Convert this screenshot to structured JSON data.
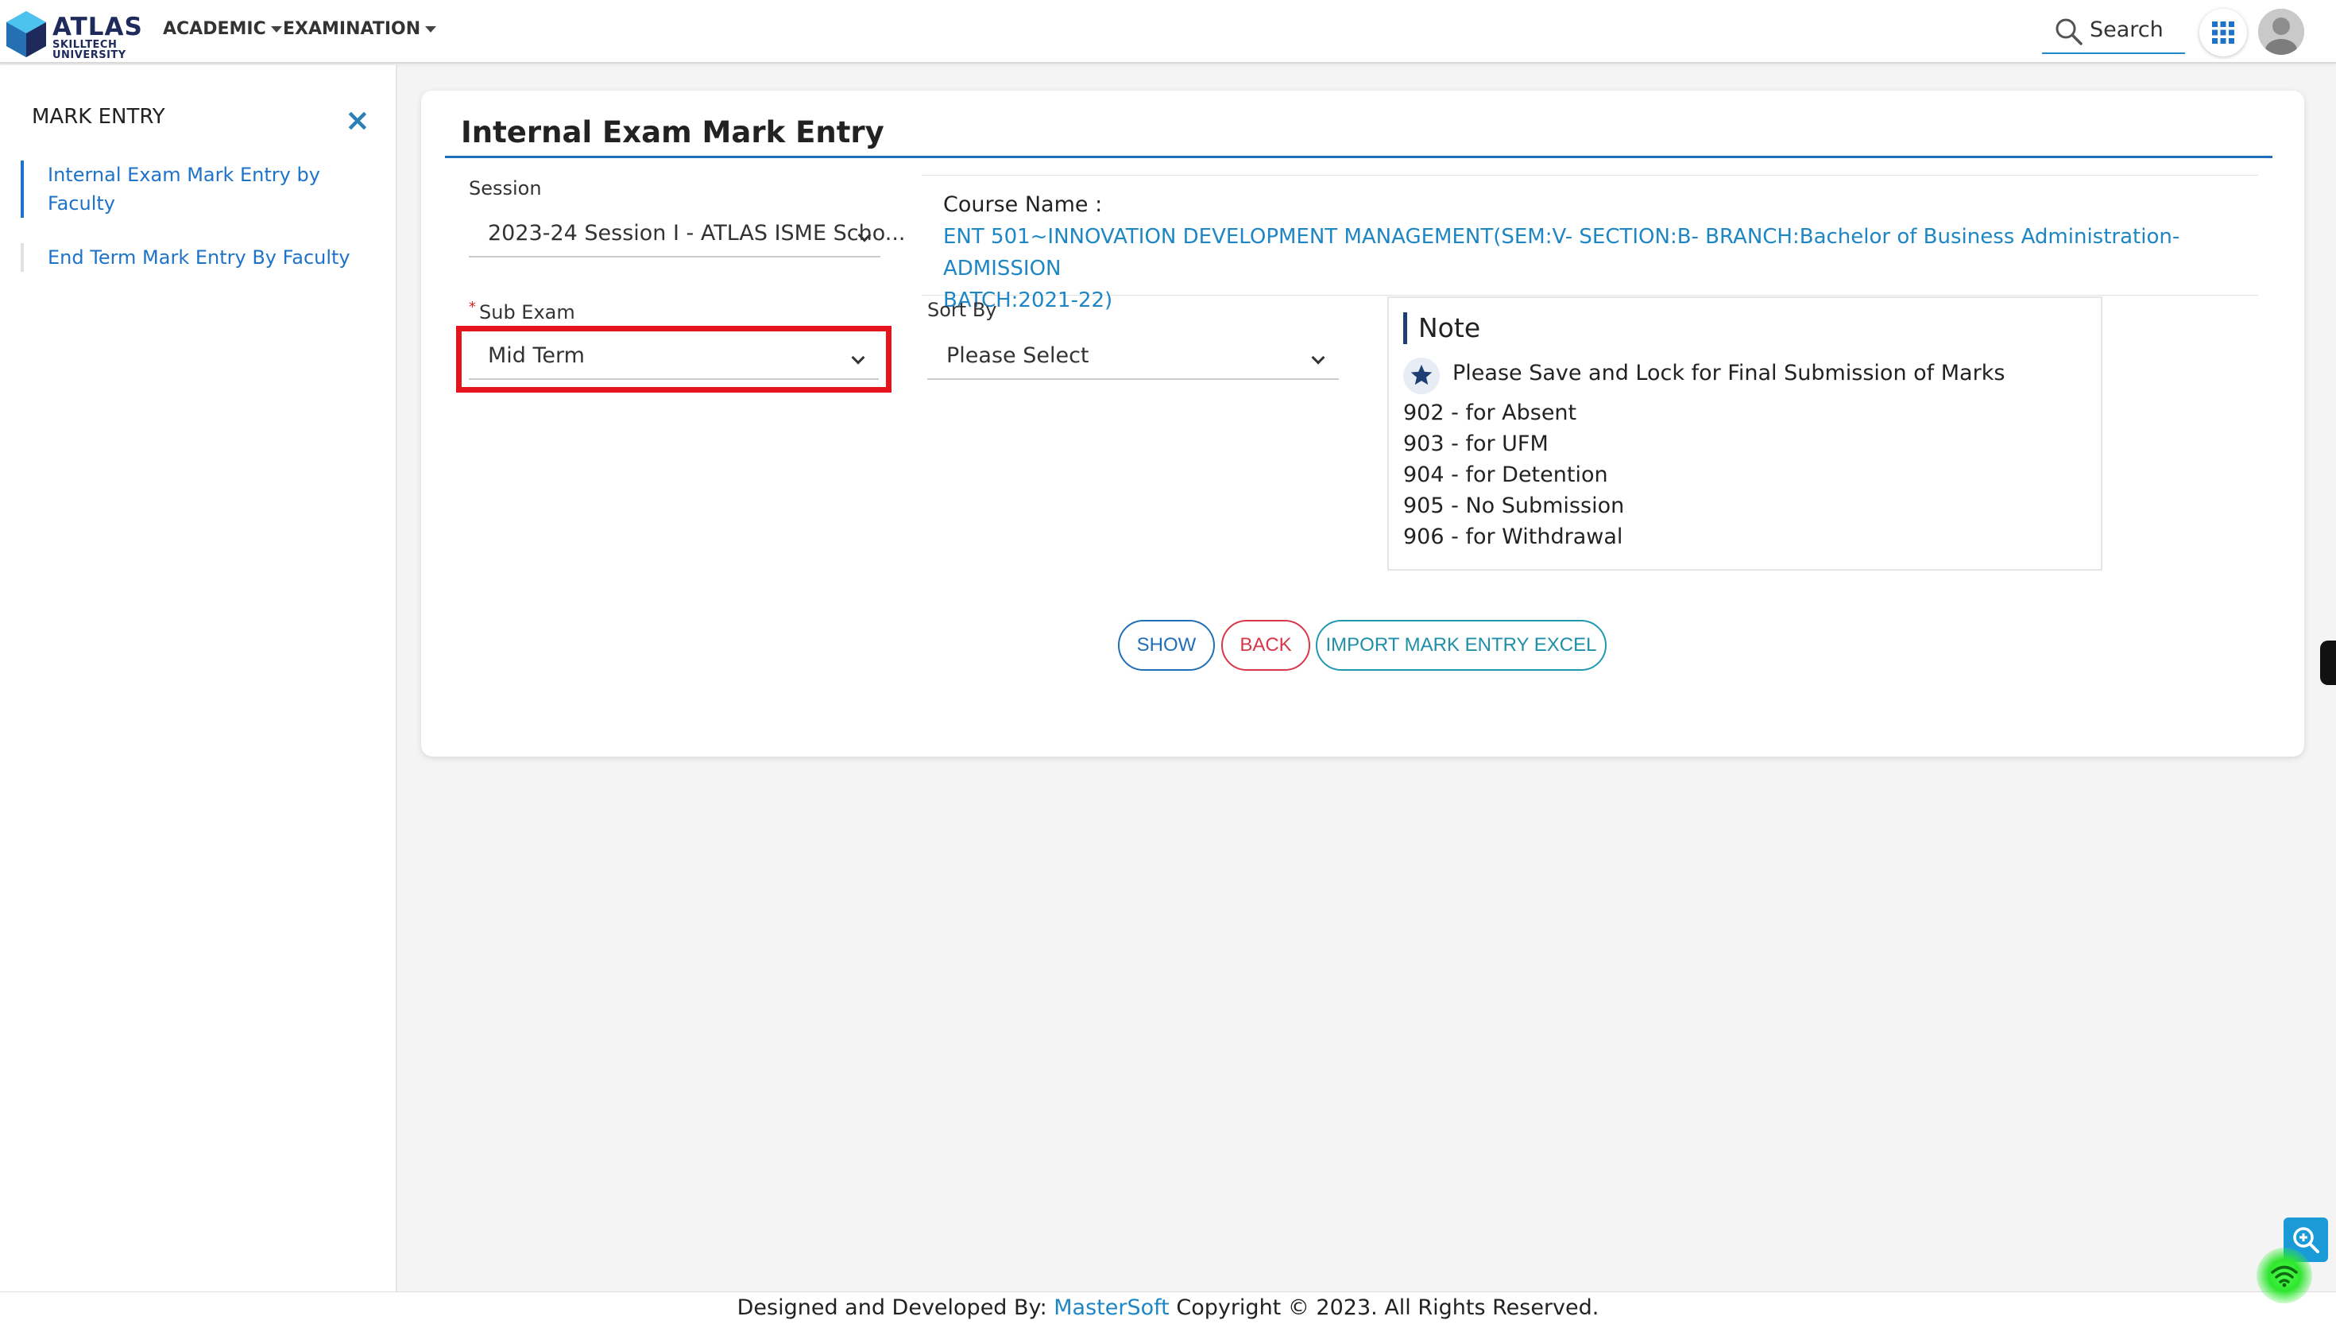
{
  "brand": {
    "logo_line1": "ATLAS",
    "logo_line2": "SKILLTECH",
    "logo_line3": "UNIVERSITY",
    "accent_color": "#1e73c8"
  },
  "topnav": {
    "academic": "ACADEMIC",
    "examination": "EXAMINATION",
    "search_label": "Search"
  },
  "sidebar": {
    "title": "MARK ENTRY",
    "items": [
      {
        "label_line1": "Internal Exam Mark Entry by",
        "label_line2": "Faculty",
        "active": true
      },
      {
        "label_line1": "End Term Mark Entry By Faculty",
        "label_line2": "",
        "active": false
      }
    ]
  },
  "form": {
    "page_title": "Internal Exam Mark Entry",
    "session": {
      "label": "Session",
      "value": "2023-24 Session I - ATLAS ISME Scho..."
    },
    "course": {
      "label": "Course Name :",
      "line1": "ENT 501~INNOVATION DEVELOPMENT MANAGEMENT(SEM:V- SECTION:B- BRANCH:Bachelor of Business Administration- ADMISSION",
      "line2": "BATCH:2021-22)"
    },
    "sub_exam": {
      "required_mark": "*",
      "label": "Sub Exam",
      "value": "Mid Term"
    },
    "sort_by": {
      "label": "Sort By",
      "value": "Please Select"
    }
  },
  "note": {
    "title": "Note",
    "main": "Please Save and Lock for Final Submission of Marks",
    "codes": [
      "902 - for Absent",
      "903 - for UFM",
      "904 - for Detention",
      "905 - No Submission",
      "906 - for Withdrawal"
    ]
  },
  "buttons": {
    "show": "SHOW",
    "back": "BACK",
    "import": "IMPORT MARK ENTRY EXCEL"
  },
  "footer": {
    "prefix": "Designed and Developed By:",
    "brand": "MasterSoft",
    "suffix": "Copyright © 2023. All Rights Reserved."
  },
  "icons": {
    "search": "search-icon",
    "apps": "apps-grid-icon",
    "close": "close-icon",
    "star": "star-icon",
    "zoom": "zoom-icon",
    "wifi": "wifi-icon"
  }
}
